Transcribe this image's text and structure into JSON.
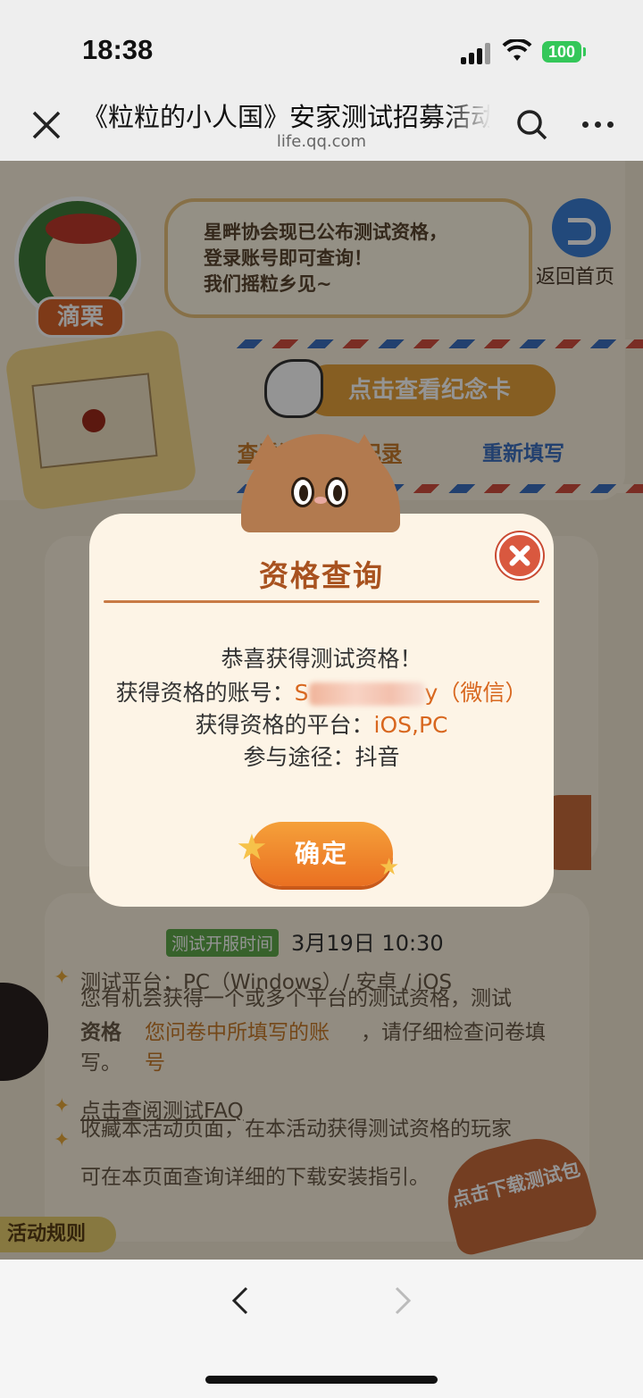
{
  "status_bar": {
    "time": "18:38",
    "battery": "100"
  },
  "nav": {
    "title": "《粒粒的小人国》安家测试招募活动",
    "domain": "life.qq.com"
  },
  "background": {
    "character_name": "滴栗",
    "bubble_lines": [
      "星畔协会现已公布测试资格，",
      "登录账号即可查询！",
      "我们摇粒乡见~"
    ],
    "home_label": "返回首页",
    "view_card_label": "点击查看纪念卡",
    "view_record_label": "查看问卷填写记录",
    "refill_label": "重新填写",
    "open_time_tag": "测试开服时间",
    "open_time_value": "3月19日 10:30",
    "platform_line": "测试平台：PC（Windows）/ 安卓 / iOS",
    "info_line_1": "您有机会获得一个或多个平台的测试资格，测试",
    "info_line_2": "资格",
    "info_line_3": "您问卷中所填写的账号",
    "info_line_4": "，请仔细检查问卷填",
    "info_line_5": "写。",
    "faq_label": "点击查阅测试FAQ",
    "save_line_1": "收藏本活动页面，在本活动获得测试资格的玩家",
    "save_line_2": "可在本页面查询详细的下载安装指引。",
    "download_label": "点击下载测试包",
    "rules_label": "活动规则"
  },
  "dialog": {
    "title": "资格查询",
    "line1": "恭喜获得测试资格！",
    "account_label": "获得资格的账号：",
    "account_prefix": "S",
    "account_suffix": "y（微信）",
    "platform_label": "获得资格的平台：",
    "platform_value": "iOS,PC",
    "channel_label": "参与途径：",
    "channel_value": "抖音",
    "confirm_label": "确定"
  },
  "colors": {
    "accent": "#d8671f",
    "title": "#a8521f",
    "confirm": "#ea7021"
  }
}
